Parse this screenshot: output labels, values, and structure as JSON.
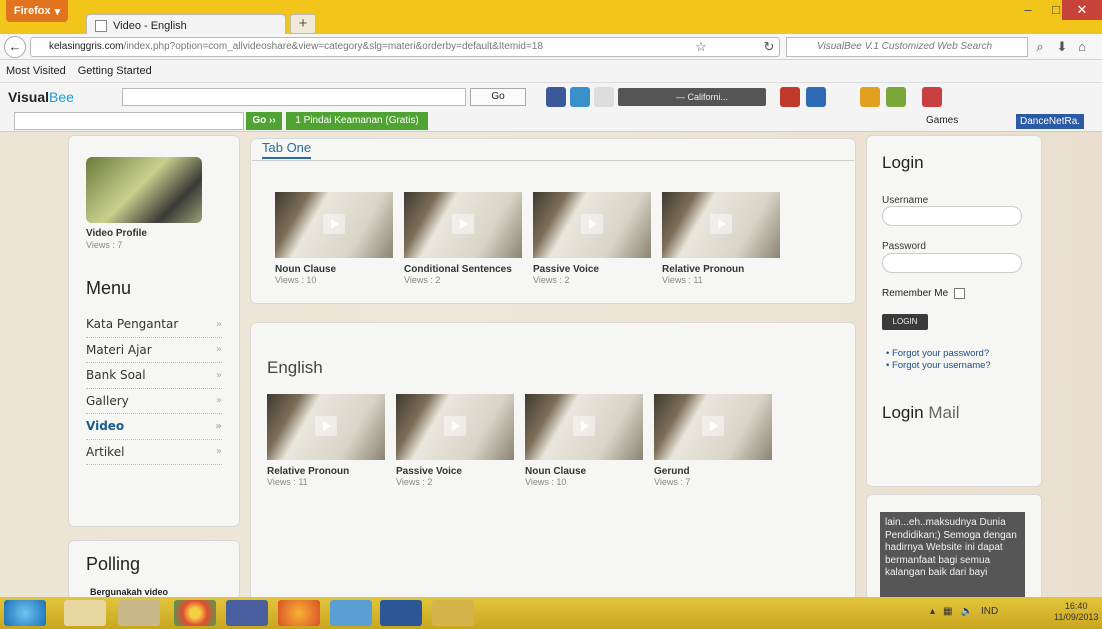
{
  "browser": {
    "menu_button": "Firefox",
    "tab_title": "Video - English",
    "new_tab": "+",
    "url_host": "kelasinggris.com",
    "url_path": "/index.php?option=com_allvideoshare&view=category&slg=materi&orderby=default&Itemid=18",
    "search_placeholder": "VisualBee V.1 Customized Web Search",
    "window_controls": [
      "–",
      "□",
      "✕"
    ]
  },
  "bookmarks": [
    "Most Visited",
    "Getting Started"
  ],
  "visualbee": {
    "logo_a": "Visual",
    "logo_b": "Bee",
    "go_label": "Go",
    "radio_label": "— Californi...",
    "search_go": "Go ››",
    "pindai_label": "1 Pindai Keamanan (Gratis)",
    "games_label": "Games",
    "dance_label": "DanceNetRa."
  },
  "sidebar": {
    "video_title": "Video Profile",
    "video_views": "Views : 7",
    "menu_title": "Menu",
    "menu_items": [
      {
        "label": "Kata Pengantar",
        "arrow": "»"
      },
      {
        "label": "Materi Ajar",
        "arrow": "»"
      },
      {
        "label": "Bank Soal",
        "arrow": "»"
      },
      {
        "label": "Gallery",
        "arrow": "»"
      },
      {
        "label": "Video",
        "arrow": "»"
      },
      {
        "label": "Artikel",
        "arrow": "»"
      }
    ],
    "poll_title": "Polling",
    "poll_question": "Bergunakah video"
  },
  "main": {
    "tab_label": "Tab One",
    "tab_videos": [
      {
        "title": "Noun Clause",
        "views": "Views : 10"
      },
      {
        "title": "Conditional Sentences",
        "views": "Views : 2"
      },
      {
        "title": "Passive Voice",
        "views": "Views : 2"
      },
      {
        "title": "Relative Pronoun",
        "views": "Views : 11"
      }
    ],
    "section_title": "English",
    "english_videos": [
      {
        "title": "Relative Pronoun",
        "views": "Views : 11"
      },
      {
        "title": "Passive Voice",
        "views": "Views : 2"
      },
      {
        "title": "Noun Clause",
        "views": "Views : 10"
      },
      {
        "title": "Gerund",
        "views": "Views : 7"
      }
    ]
  },
  "login": {
    "title": "Login",
    "username_label": "Username",
    "password_label": "Password",
    "remember_label": "Remember Me",
    "button_label": "LOGIN",
    "links": [
      "Forgot your password?",
      "Forgot your username?"
    ],
    "mail_title_a": "Login",
    "mail_title_b": "Mail",
    "quote": "lain...eh..maksudnya Dunia Pendidikan;) Semoga dengan hadirnya Website ini dapat bermanfaat bagi semua kalangan baik dari bayi"
  },
  "taskbar": {
    "lang": "IND",
    "time": "16:40",
    "date": "11/09/2013"
  }
}
